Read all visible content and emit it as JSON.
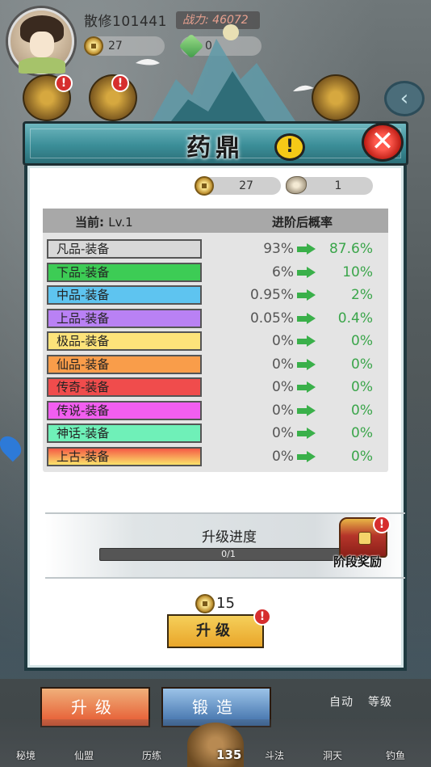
{
  "player": {
    "name": "散修101441",
    "power_label": "战力: 46072"
  },
  "top_resources": {
    "coin": "27",
    "jade": "0"
  },
  "modal": {
    "title": "药鼎",
    "info_icon": "!",
    "close_icon": "✕",
    "currency": {
      "coin": "27",
      "stone": "1"
    },
    "table": {
      "header_left_prefix": "当前: ",
      "header_level": "Lv.1",
      "header_right": "进阶后概率",
      "rows": [
        {
          "grade": "凡品-装备",
          "color": "#d8d8d8",
          "current": "93%",
          "next": "87.6%"
        },
        {
          "grade": "下品-装备",
          "color": "#3dcc55",
          "current": "6%",
          "next": "10%"
        },
        {
          "grade": "中品-装备",
          "color": "#5ec4f0",
          "current": "0.95%",
          "next": "2%"
        },
        {
          "grade": "上品-装备",
          "color": "#b981f4",
          "current": "0.05%",
          "next": "0.4%"
        },
        {
          "grade": "极品-装备",
          "color": "#fde37a",
          "current": "0%",
          "next": "0%"
        },
        {
          "grade": "仙品-装备",
          "color": "#f99d4a",
          "current": "0%",
          "next": "0%"
        },
        {
          "grade": "传奇-装备",
          "color": "#f04c4c",
          "current": "0%",
          "next": "0%"
        },
        {
          "grade": "传说-装备",
          "color": "#f25ef0",
          "current": "0%",
          "next": "0%"
        },
        {
          "grade": "神话-装备",
          "color": "#6ff0b8",
          "current": "0%",
          "next": "0%"
        },
        {
          "grade": "上古-装备",
          "color": "linear-gradient(180deg,#f55a45,#fbe36a)",
          "current": "0%",
          "next": "0%"
        }
      ]
    },
    "progress": {
      "title": "升级进度",
      "value": 0,
      "max": 1,
      "text": "0/1",
      "reward_label": "阶段奖励"
    },
    "cost": "15",
    "upgrade_button": "升级"
  },
  "tabs": {
    "upgrade": "升级",
    "forge": "锻造"
  },
  "side_labels": {
    "auto": "自动",
    "level": "等级"
  },
  "nav": {
    "items": [
      "秘境",
      "仙盟",
      "历练",
      "斗法",
      "洞天",
      "钓鱼"
    ],
    "center_count": "135"
  },
  "colors": {
    "accent_green": "#3aa54a",
    "header_teal": "#3b8e98",
    "button_gold": "#e9a62a",
    "alert_red": "#d62e2e"
  },
  "icons": {
    "coin": "coin-icon",
    "stone": "stone-icon",
    "arrow": "arrow-right-icon",
    "close": "close-icon",
    "info": "info-icon",
    "chest": "chest-icon",
    "alert": "alert-icon"
  }
}
